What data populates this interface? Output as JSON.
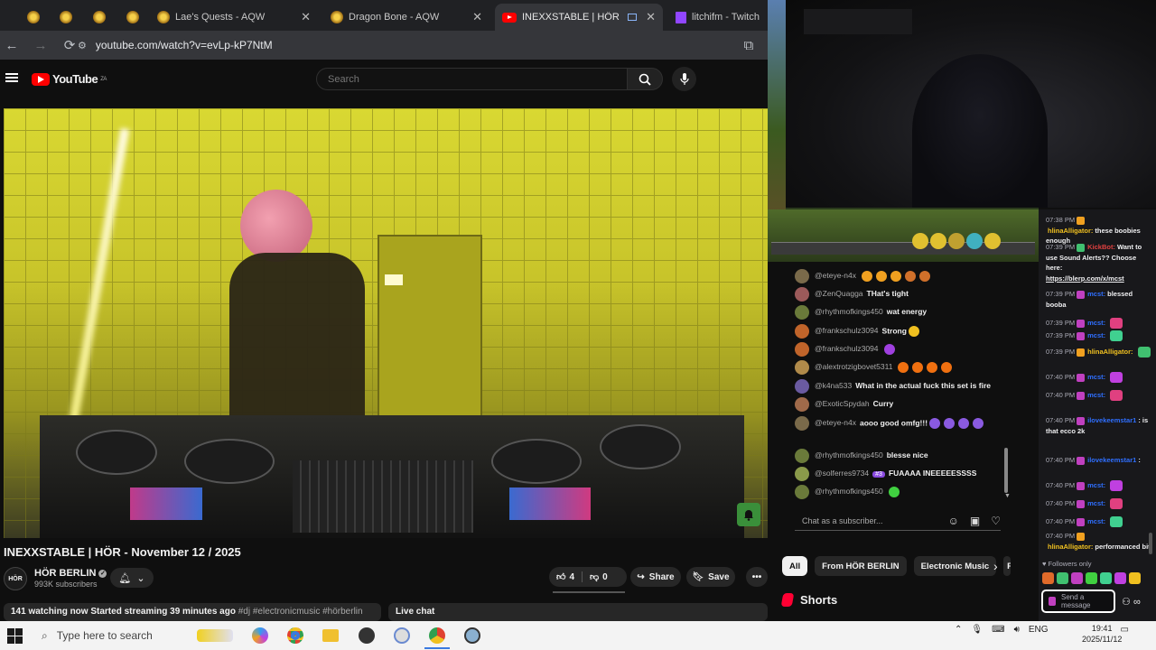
{
  "browser": {
    "tabs": [
      {
        "title": "",
        "favicon": "aqw-icon"
      },
      {
        "title": "",
        "favicon": "aqw-icon"
      },
      {
        "title": "",
        "favicon": "aqw-icon"
      },
      {
        "title": "",
        "favicon": "aqw-icon"
      },
      {
        "title": "Lae's Quests - AQW",
        "favicon": "aqw-icon"
      },
      {
        "title": "Dragon Bone - AQW",
        "favicon": "aqw-icon"
      },
      {
        "title": "INEXXSTABLE | HÖR - Nove",
        "favicon": "youtube-icon",
        "active": true
      },
      {
        "title": "litchifm - Twitch",
        "favicon": "twitch-icon"
      }
    ],
    "close_glyph": "✕",
    "url": "youtube.com/watch?v=evLp-kP7NtM"
  },
  "youtube": {
    "logo_text": "YouTube",
    "logo_region": "ZA",
    "search_placeholder": "Search",
    "video_title": "INEXXSTABLE | HÖR - November 12 / 2025",
    "channel": {
      "avatar_text": "HÖR",
      "name": "HÖR BERLIN",
      "subscribers": "993K subscribers"
    },
    "likes": "4",
    "dislikes": "0",
    "share_label": "Share",
    "save_label": "Save",
    "description_stats": "141 watching now  Started streaming 39 minutes ago",
    "description_tags": "#dj #electronicmusic #hörberlin",
    "live_chat_label": "Live chat",
    "chat_input_placeholder": "Chat as a subscriber...",
    "chips": [
      "All",
      "From HÖR BERLIN",
      "Electronic Music",
      "F"
    ],
    "shorts_label": "Shorts"
  },
  "yt_chat": [
    {
      "author": "@eteye-n4x",
      "text": "",
      "avatar_color": "#7a6a4a",
      "emojis": [
        "#f0a020",
        "#f0a020",
        "#f0a020",
        "#d0702a",
        "#d0702a"
      ]
    },
    {
      "author": "@ZenQuagga",
      "text": "THat's tight",
      "avatar_color": "#9c5a5a",
      "emojis": []
    },
    {
      "author": "@rhythmofkings450",
      "text": "wat energy",
      "avatar_color": "#6a7a3a",
      "emojis": []
    },
    {
      "author": "@frankschulz3094",
      "text": "Strong",
      "avatar_color": "#c0642a",
      "emojis": [
        "#f0c020"
      ]
    },
    {
      "author": "@frankschulz3094",
      "text": "",
      "avatar_color": "#c0642a",
      "emojis": [
        "#a040e0"
      ]
    },
    {
      "author": "@alextrotzigbovet5311",
      "text": "",
      "avatar_color": "#b08a4a",
      "emojis": [
        "#f07010",
        "#f07010",
        "#f07010",
        "#f07010"
      ]
    },
    {
      "author": "@k4na533",
      "text": "What in the actual fuck this set is fire",
      "avatar_color": "#6a5aa0",
      "emojis": []
    },
    {
      "author": "@ExoticSpydah",
      "text": "Curry",
      "avatar_color": "#a06a4a",
      "emojis": []
    },
    {
      "author": "@eteye-n4x",
      "text": "aooo good omfg!!!",
      "avatar_color": "#7a6a4a",
      "emojis": [
        "#8a5ae0",
        "#8a5ae0",
        "#8a5ae0",
        "#8a5ae0"
      ]
    },
    {
      "author": "@rhythmofkings450",
      "text": "blesse nice",
      "avatar_color": "#6a7a3a",
      "emojis": []
    },
    {
      "author": "@solferres9734",
      "text": "FUAAAA INEEEEESSSS",
      "avatar_color": "#8a9a4a",
      "emojis": [],
      "badge": "#3"
    },
    {
      "author": "@rhythmofkings450",
      "text": "",
      "avatar_color": "#6a7a3a",
      "emojis": [
        "#40d040"
      ]
    }
  ],
  "twitch_chat": [
    {
      "time": "07:38 PM",
      "user": "hlinaAlligator:",
      "color": "#f0c020",
      "text": "these boobies enough"
    },
    {
      "time": "07:39 PM",
      "user": "KickBot:",
      "color": "#e04040",
      "text": "Want to use Sound Alerts?? Choose here:",
      "link": "https://blerp.com/x/mcst"
    },
    {
      "time": "07:39 PM",
      "user": "mcst:",
      "color": "#2f6fff",
      "text": "blessed booba"
    },
    {
      "time": "07:39 PM",
      "user": "mcst:",
      "color": "#2f6fff",
      "text": ""
    },
    {
      "time": "07:39 PM",
      "user": "mcst:",
      "color": "#2f6fff",
      "text": ""
    },
    {
      "time": "07:39 PM",
      "user": "hlinaAlligator:",
      "color": "#f0c020",
      "text": ""
    },
    {
      "time": "07:40 PM",
      "user": "mcst:",
      "color": "#2f6fff",
      "text": ""
    },
    {
      "time": "07:40 PM",
      "user": "mcst:",
      "color": "#2f6fff",
      "text": ""
    },
    {
      "time": "07:40 PM",
      "user": "ilovekeemstar1",
      "color": "#2f6fff",
      "text": ": is that ecco 2k"
    },
    {
      "time": "07:40 PM",
      "user": "ilovekeemstar1",
      "color": "#2f6fff",
      "text": ":"
    },
    {
      "time": "07:40 PM",
      "user": "mcst:",
      "color": "#2f6fff",
      "text": ""
    },
    {
      "time": "07:40 PM",
      "user": "mcst:",
      "color": "#2f6fff",
      "text": ""
    },
    {
      "time": "07:40 PM",
      "user": "mcst:",
      "color": "#2f6fff",
      "text": ""
    },
    {
      "time": "07:40 PM",
      "user": "hlinaAlligator:",
      "color": "#f0c020",
      "text": "performanced bit"
    }
  ],
  "twitch": {
    "followers_only": "Followers only",
    "input_placeholder": "Send a message"
  },
  "taskbar": {
    "search_placeholder": "Type here to search",
    "lang": "ENG",
    "time": "19:41",
    "date": "2025/11/12"
  }
}
